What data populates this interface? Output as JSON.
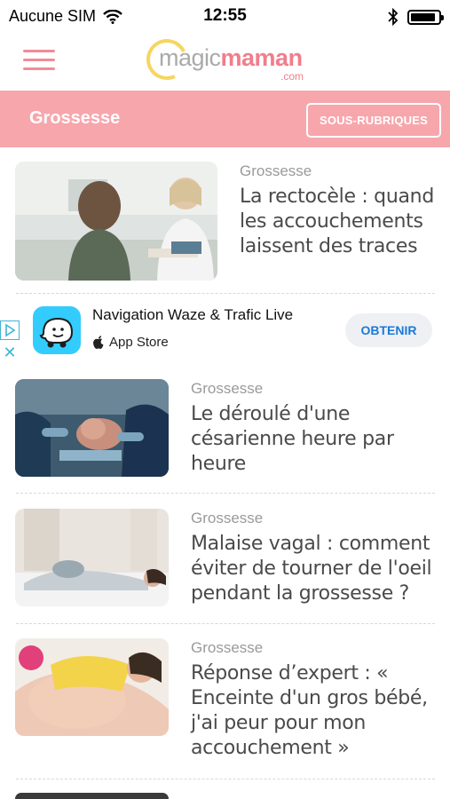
{
  "status_bar": {
    "carrier": "Aucune SIM",
    "time": "12:55",
    "icons": [
      "wifi-icon",
      "bluetooth-icon",
      "battery-icon"
    ]
  },
  "header": {
    "logo_magic": "magic",
    "logo_maman": "maman",
    "logo_com": ".com",
    "menu_icon": "hamburger-icon"
  },
  "section": {
    "title": "Grossesse",
    "sub_button": "SOUS-RUBRIQUES"
  },
  "colors": {
    "brand_pink": "#f7a6ac",
    "logo_pink": "#f07e8c",
    "logo_yellow": "#f7d560",
    "ad_blue": "#1a7ad8"
  },
  "ad": {
    "title": "Navigation Waze & Trafic Live",
    "store": "App Store",
    "button": "OBTENIR"
  },
  "articles": [
    {
      "category": "Grossesse",
      "title": "La rectocèle : quand les accouchements laissent des traces"
    },
    {
      "category": "Grossesse",
      "title": "Le déroulé d'une césarienne heure par heure"
    },
    {
      "category": "Grossesse",
      "title": "Malaise vagal : comment éviter de tourner de l'oeil pendant la grossesse ?"
    },
    {
      "category": "Grossesse",
      "title": "Réponse d’expert : « Enceinte d'un gros bébé, j'ai peur pour mon accouchement »"
    }
  ]
}
